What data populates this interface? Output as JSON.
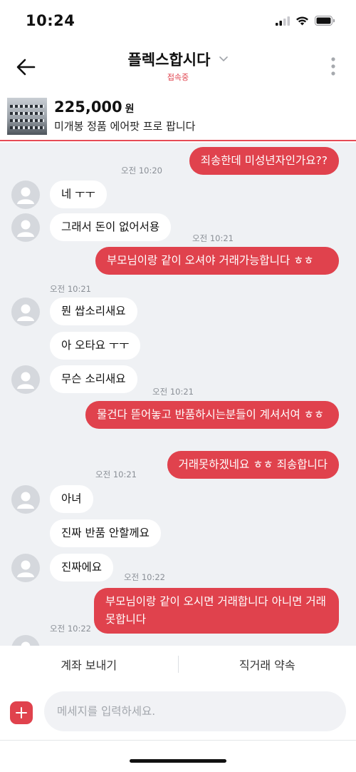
{
  "status": {
    "time": "10:24"
  },
  "header": {
    "title": "플렉스합시다",
    "subtitle": "접속중"
  },
  "product": {
    "price": "225,000",
    "currency": "원",
    "name": "미개봉 정품 에어팟 프로 팝니다"
  },
  "messages": [
    {
      "text": "죄송한데 미성년자인가요??",
      "time": "오전 10:20"
    },
    {
      "text": "네 ㅜㅜ"
    },
    {
      "text": "그래서 돈이 없어서용",
      "time": "오전 10:21"
    },
    {
      "text": "부모님이랑 같이 오셔야 거래가능합니다 ㅎㅎ",
      "time": "오전 10:21"
    },
    {
      "text": "뭔 쌉소리새요"
    },
    {
      "text": "아 오타요 ㅜㅜ"
    },
    {
      "text": "무슨 소리새요",
      "time": "오전 10:21"
    },
    {
      "text": "물건다 뜯어놓고 반품하시는분들이 계셔서여 ㅎㅎ"
    },
    {
      "text": "거래못하겠네요 ㅎㅎ 죄송합니다",
      "time": "오전 10:21"
    },
    {
      "text": "아녀"
    },
    {
      "text": "진짜 반품 안할께요"
    },
    {
      "text": "진짜에요",
      "time": "오전 10:22"
    },
    {
      "text": "부모님이랑 같이 오시면 거래합니다 아니면 거래못합니다",
      "time": "오전 10:22"
    }
  ],
  "actions": {
    "send_money": "계좌 보내기",
    "meet": "직거래 약속"
  },
  "composer": {
    "placeholder": "메세지를 입력하세요."
  },
  "colors": {
    "accent": "#e0424d",
    "chat_bg": "#eff1f4"
  }
}
